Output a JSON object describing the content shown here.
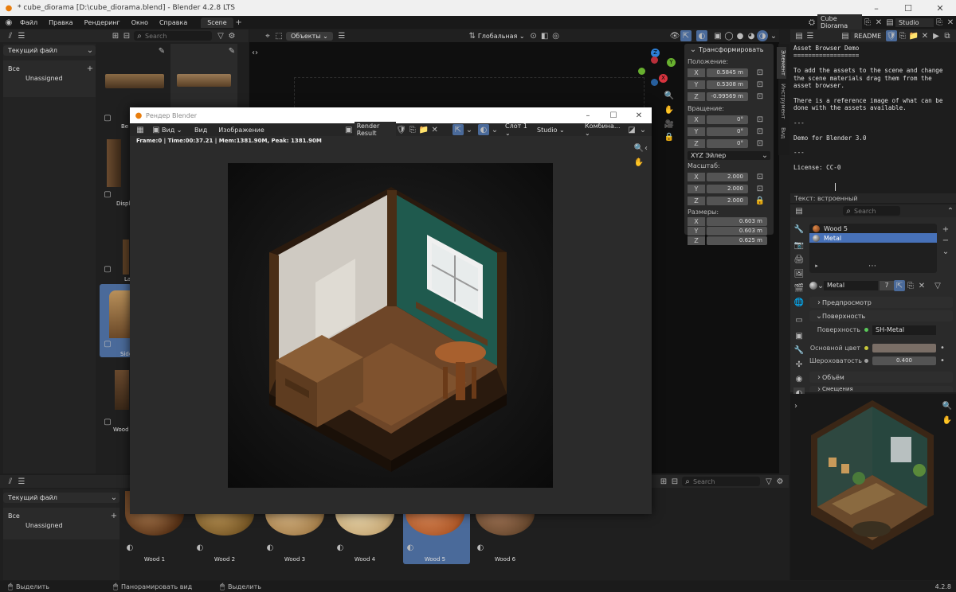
{
  "window": {
    "title": "* cube_diorama [D:\\cube_diorama.blend] - Blender 4.2.8 LTS"
  },
  "menu": [
    "Файл",
    "Правка",
    "Рендеринг",
    "Окно",
    "Справка"
  ],
  "workspace_tab": "Scene",
  "top_right": {
    "scene": "Cube Diorama",
    "layer": "Studio"
  },
  "asset_browser_top": {
    "search_placeholder": "Search",
    "library": "Текущий файл",
    "tree_all": "Все",
    "tree_unassigned": "Unassigned",
    "items": [
      "Be",
      "Displ",
      "La",
      "Side",
      "Wood"
    ]
  },
  "viewport": {
    "mode": "Объекты",
    "orientation": "Глобальная"
  },
  "render_window": {
    "title": "Рендер Blender",
    "menu_view": "Вид",
    "menu_view2": "Вид",
    "menu_image": "Изображение",
    "image_name": "Render Result",
    "slot": "Слот 1",
    "layer": "Studio",
    "pass": "Комбина...",
    "stats": "Frame:0 | Time:00:37.21 | Mem:1381.90M, Peak: 1381.90M"
  },
  "transform": {
    "title": "Трансформировать",
    "location_label": "Положение:",
    "location": {
      "x": "0.5845 m",
      "y": "0.5308 m",
      "z": "-0.99569 m"
    },
    "rotation_label": "Вращение:",
    "rotation": {
      "x": "0°",
      "y": "0°",
      "z": "0°"
    },
    "rotation_mode": "XYZ Эйлер",
    "scale_label": "Масштаб:",
    "scale": {
      "x": "2.000",
      "y": "2.000",
      "z": "2.000"
    },
    "dims_label": "Размеры:",
    "dims": {
      "x": "0.603 m",
      "y": "0.603 m",
      "z": "0.625 m"
    }
  },
  "side_tabs": [
    "Элемент",
    "Инструмент",
    "Вид"
  ],
  "axis": {
    "x": "X",
    "y": "Y",
    "z": "Z"
  },
  "text_editor": {
    "doc_name": "README",
    "lines": [
      "Asset Browser Demo",
      "==================",
      "",
      "To add the assets to the scene and change",
      "the scene materials drag them from the",
      "asset browser.",
      "",
      "There is a reference image of what can be",
      "done with the assets available.",
      "",
      "---",
      "",
      "Demo for Blender 3.0",
      "",
      "---",
      "",
      "License: CC-0"
    ],
    "footer": "Текст: встроенный"
  },
  "properties": {
    "search_placeholder": "Search",
    "slots": [
      "Wood 5",
      "Metal"
    ],
    "material_name": "Metal",
    "users": "7",
    "sections": {
      "preview": "Предпросмотр",
      "surface": "Поверхность",
      "volume": "Объём",
      "displacement": "Смещения"
    },
    "surface_label": "Поверхность",
    "surface_value": "SH-Metal",
    "base_color_label": "Основной цвет",
    "base_color": "#7a6e66",
    "roughness_label": "Шероховатость",
    "roughness_value": "0.400"
  },
  "asset_browser_bottom": {
    "library": "Текущий файл",
    "tree_all": "Все",
    "tree_unassigned": "Unassigned",
    "search_placeholder": "Search",
    "items": [
      "Wood 1",
      "Wood 2",
      "Wood 3",
      "Wood 4",
      "Wood 5",
      "Wood 6"
    ]
  },
  "statusbar": {
    "select1": "Выделить",
    "pan": "Панорамировать вид",
    "select2": "Выделить",
    "version": "4.2.8"
  }
}
